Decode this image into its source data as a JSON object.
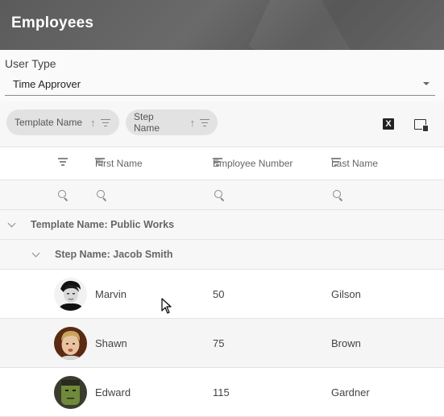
{
  "header": {
    "title": "Employees"
  },
  "user_type": {
    "label": "User Type",
    "value": "Time Approver"
  },
  "grouping": {
    "chips": [
      {
        "label": "Template Name",
        "sort": "↑"
      },
      {
        "label": "Step Name",
        "sort": "↑"
      }
    ],
    "export_excel_icon": "X"
  },
  "columns": [
    {
      "label": ""
    },
    {
      "label": "First Name"
    },
    {
      "label": "Employee Number"
    },
    {
      "label": "Last Name"
    }
  ],
  "groups": [
    {
      "text": "Template Name: Public Works"
    },
    {
      "text": "Step Name: Jacob Smith"
    }
  ],
  "rows": [
    {
      "first_name": "Marvin",
      "employee_number": "50",
      "last_name": "Gilson",
      "avatar": "elvis-portrait-icon"
    },
    {
      "first_name": "Shawn",
      "employee_number": "75",
      "last_name": "Brown",
      "avatar": "blond-man-portrait-icon"
    },
    {
      "first_name": "Edward",
      "employee_number": "115",
      "last_name": "Gardner",
      "avatar": "green-monster-portrait-icon"
    }
  ],
  "colors": {
    "header_bg": "#5f5f5f",
    "chip_bg": "#e2e2e2",
    "row_alt": "#f5f5f5"
  }
}
